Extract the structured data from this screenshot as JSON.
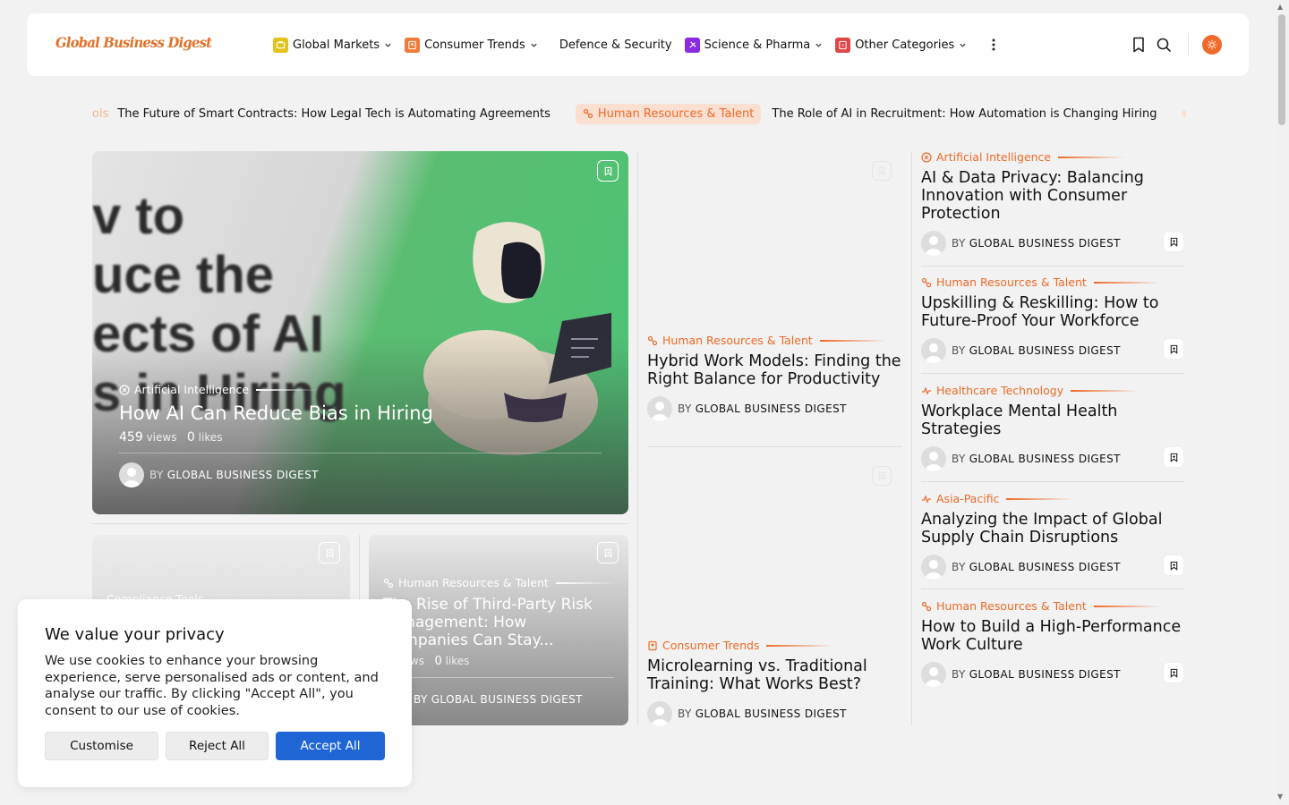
{
  "header": {
    "logo": "Global Business Digest",
    "nav": [
      {
        "label": "Global Markets",
        "icon": "markets-icon",
        "color": "#e3c21a",
        "dropdown": true
      },
      {
        "label": "Consumer Trends",
        "icon": "consumer-icon",
        "color": "#f07a3a",
        "dropdown": true
      },
      {
        "label": "Defence & Security",
        "icon": "",
        "color": "",
        "dropdown": false
      },
      {
        "label": "Science & Pharma",
        "icon": "pharma-icon",
        "color": "#8a2be2",
        "dropdown": true
      },
      {
        "label": "Other Categories",
        "icon": "categories-icon",
        "color": "#e04545",
        "dropdown": true
      }
    ]
  },
  "ticker": {
    "faded_tag": "ols",
    "item1_title": "The Future of Smart Contracts: How Legal Tech is Automating Agreements",
    "item2_tag": "Human Resources & Talent",
    "item2_title": "The Role of AI in Recruitment: How Automation is Changing Hiring"
  },
  "hero": {
    "category": "Artificial Intelligence",
    "title": "How AI Can Reduce Bias in Hiring",
    "views": "459",
    "views_label": "views",
    "likes": "0",
    "likes_label": "likes",
    "by": "BY",
    "author": "GLOBAL BUSINESS DIGEST",
    "image_text": "v to\nuce the\nects of AI\ns in Hiring"
  },
  "small_cards": [
    {
      "category": "Compliance Tools"
    },
    {
      "category": "Human Resources & Talent",
      "title": "The Rise of Third-Party Risk Management: How Companies Can Stay...",
      "views": "0",
      "views_label": "views",
      "likes": "0",
      "likes_label": "likes",
      "by": "BY",
      "author": "GLOBAL BUSINESS DIGEST"
    }
  ],
  "middle": [
    {
      "category": "Human Resources & Talent",
      "title": "Hybrid Work Models: Finding the Right Balance for Productivity",
      "by": "BY",
      "author": "GLOBAL BUSINESS DIGEST"
    },
    {
      "category": "Consumer Trends",
      "title": "Microlearning vs. Traditional Training: What Works Best?",
      "by": "BY",
      "author": "GLOBAL BUSINESS DIGEST"
    }
  ],
  "right": [
    {
      "category": "Artificial Intelligence",
      "title": "AI & Data Privacy: Balancing Innovation with Consumer Protection",
      "by": "BY",
      "author": "GLOBAL BUSINESS DIGEST"
    },
    {
      "category": "Human Resources & Talent",
      "title": "Upskilling & Reskilling: How to Future-Proof Your Workforce",
      "by": "BY",
      "author": "GLOBAL BUSINESS DIGEST"
    },
    {
      "category": "Healthcare Technology",
      "title": "Workplace Mental Health Strategies",
      "by": "BY",
      "author": "GLOBAL BUSINESS DIGEST"
    },
    {
      "category": "Asia-Pacific",
      "title": "Analyzing the Impact of Global Supply Chain Disruptions",
      "by": "BY",
      "author": "GLOBAL BUSINESS DIGEST"
    },
    {
      "category": "Human Resources & Talent",
      "title": "How to Build a High-Performance Work Culture",
      "by": "BY",
      "author": "GLOBAL BUSINESS DIGEST"
    }
  ],
  "cookie": {
    "title": "We value your privacy",
    "body": "We use cookies to enhance your browsing experience, serve personalised ads or content, and analyse our traffic. By clicking \"Accept All\", you consent to our use of cookies.",
    "customise": "Customise",
    "reject": "Reject All",
    "accept": "Accept All"
  },
  "colors": {
    "accent": "#ee6a28",
    "primary_button": "#1f65d6",
    "background": "#f2f2f2"
  }
}
